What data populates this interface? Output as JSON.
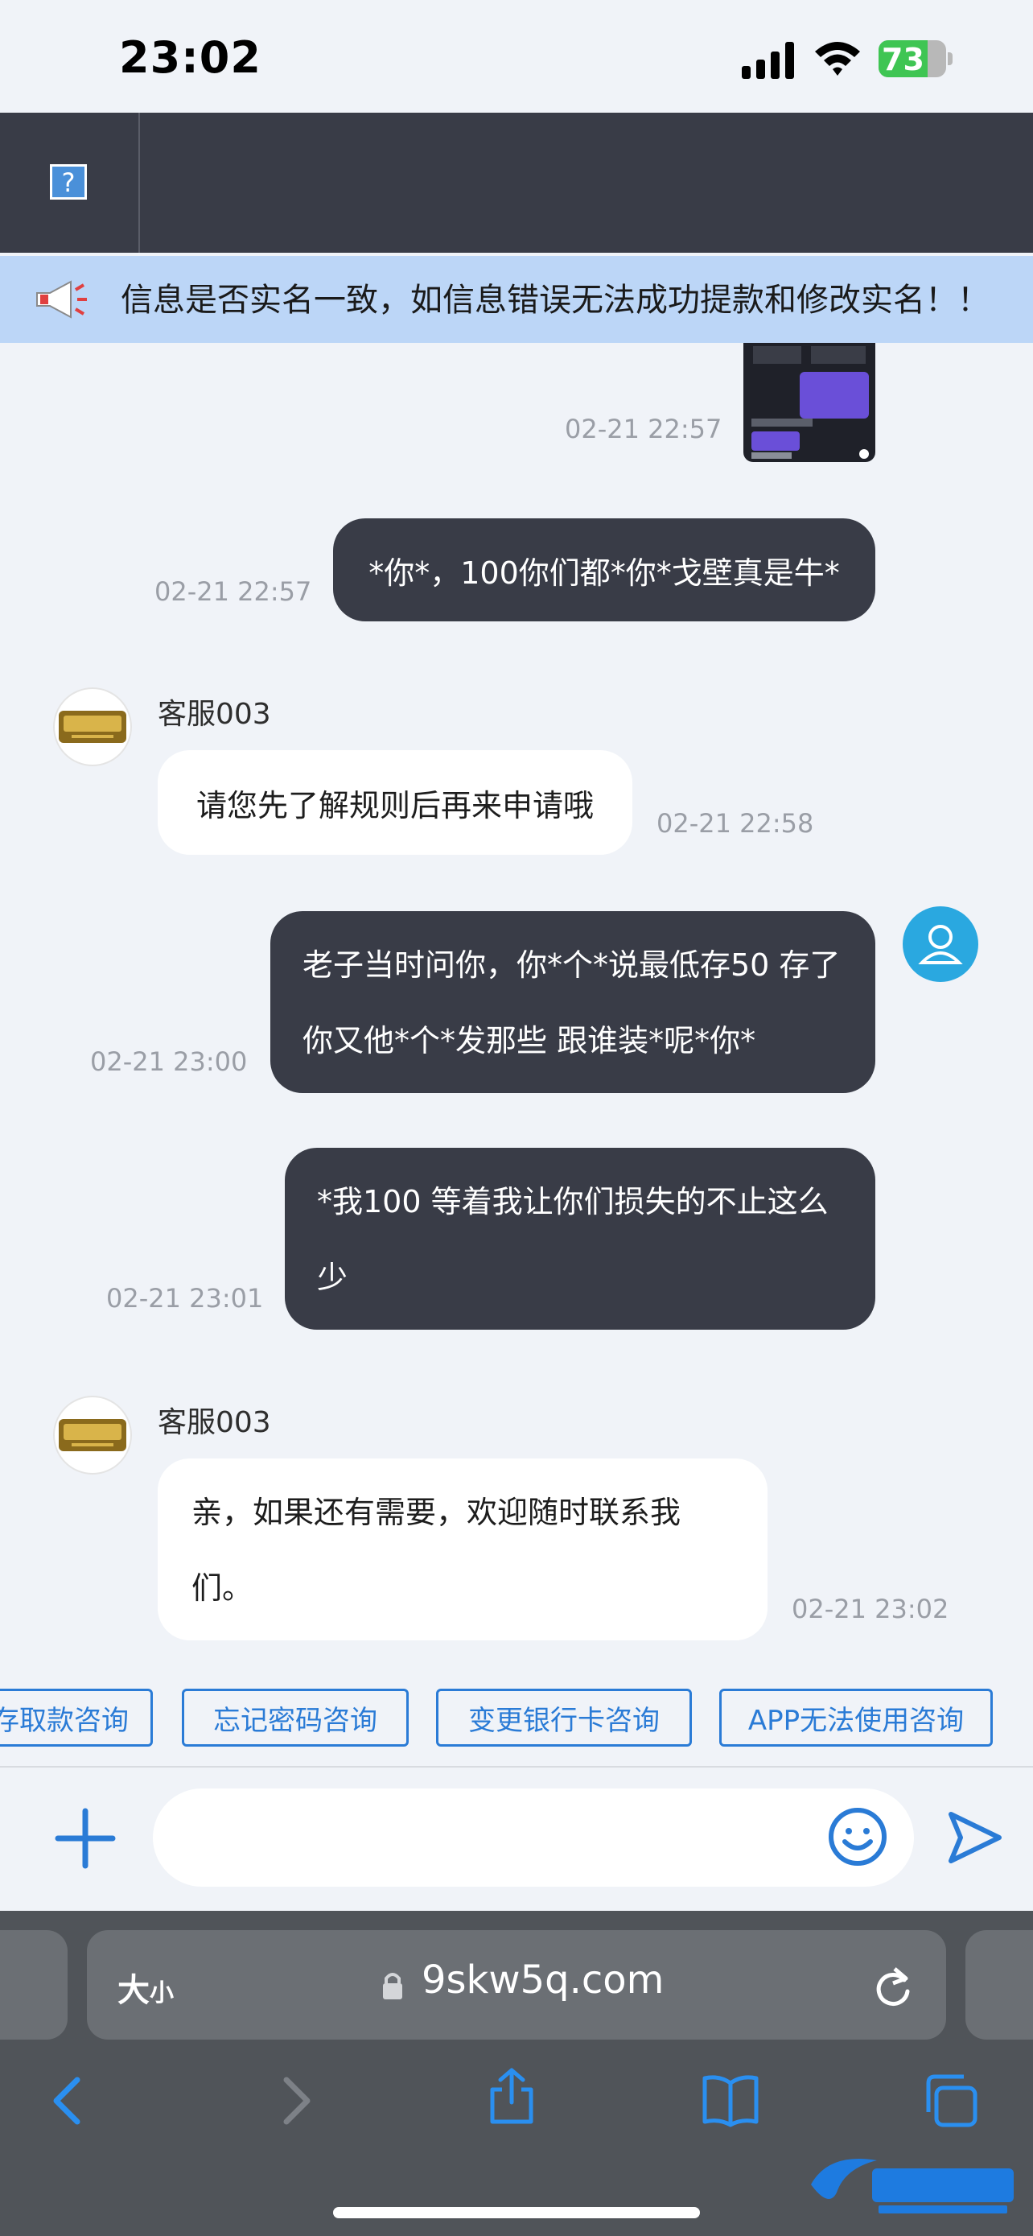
{
  "status_bar": {
    "time": "23:02",
    "battery": "73",
    "battery_level": 0.73
  },
  "notice": {
    "text": "信息是否实名一致，如信息错误无法成功提款和修改实名！！"
  },
  "messages": [
    {
      "side": "right",
      "type": "image",
      "time": "02-21 22:57"
    },
    {
      "side": "right",
      "type": "text",
      "text": "*你*，100你们都*你*戈壁真是牛*",
      "time": "02-21 22:57"
    },
    {
      "side": "left",
      "sender": "客服003",
      "text": "请您先了解规则后再来申请哦",
      "time": "02-21 22:58"
    },
    {
      "side": "right",
      "type": "text",
      "text": "老子当时问你，你*个*说最低存50 存了你又他*个*发那些 跟谁装*呢*你*",
      "time": "02-21 23:00"
    },
    {
      "side": "right",
      "type": "text",
      "text": "*我100 等着我让你们损失的不止这么少",
      "time": "02-21 23:01"
    },
    {
      "side": "left",
      "sender": "客服003",
      "text": "亲，如果还有需要，欢迎随时联系我们。",
      "time": "02-21 23:02"
    }
  ],
  "quick_replies": [
    "存取款咨询",
    "忘记密码咨询",
    "变更银行卡咨询",
    "APP无法使用咨询"
  ],
  "input": {
    "placeholder": ""
  },
  "browser": {
    "text_size": "大",
    "text_size_small": "小",
    "url": "9skw5q.com"
  },
  "colors": {
    "dark_bubble": "#393c47",
    "accent": "#2a7bd6",
    "notice_bg": "#bcd6f7"
  }
}
